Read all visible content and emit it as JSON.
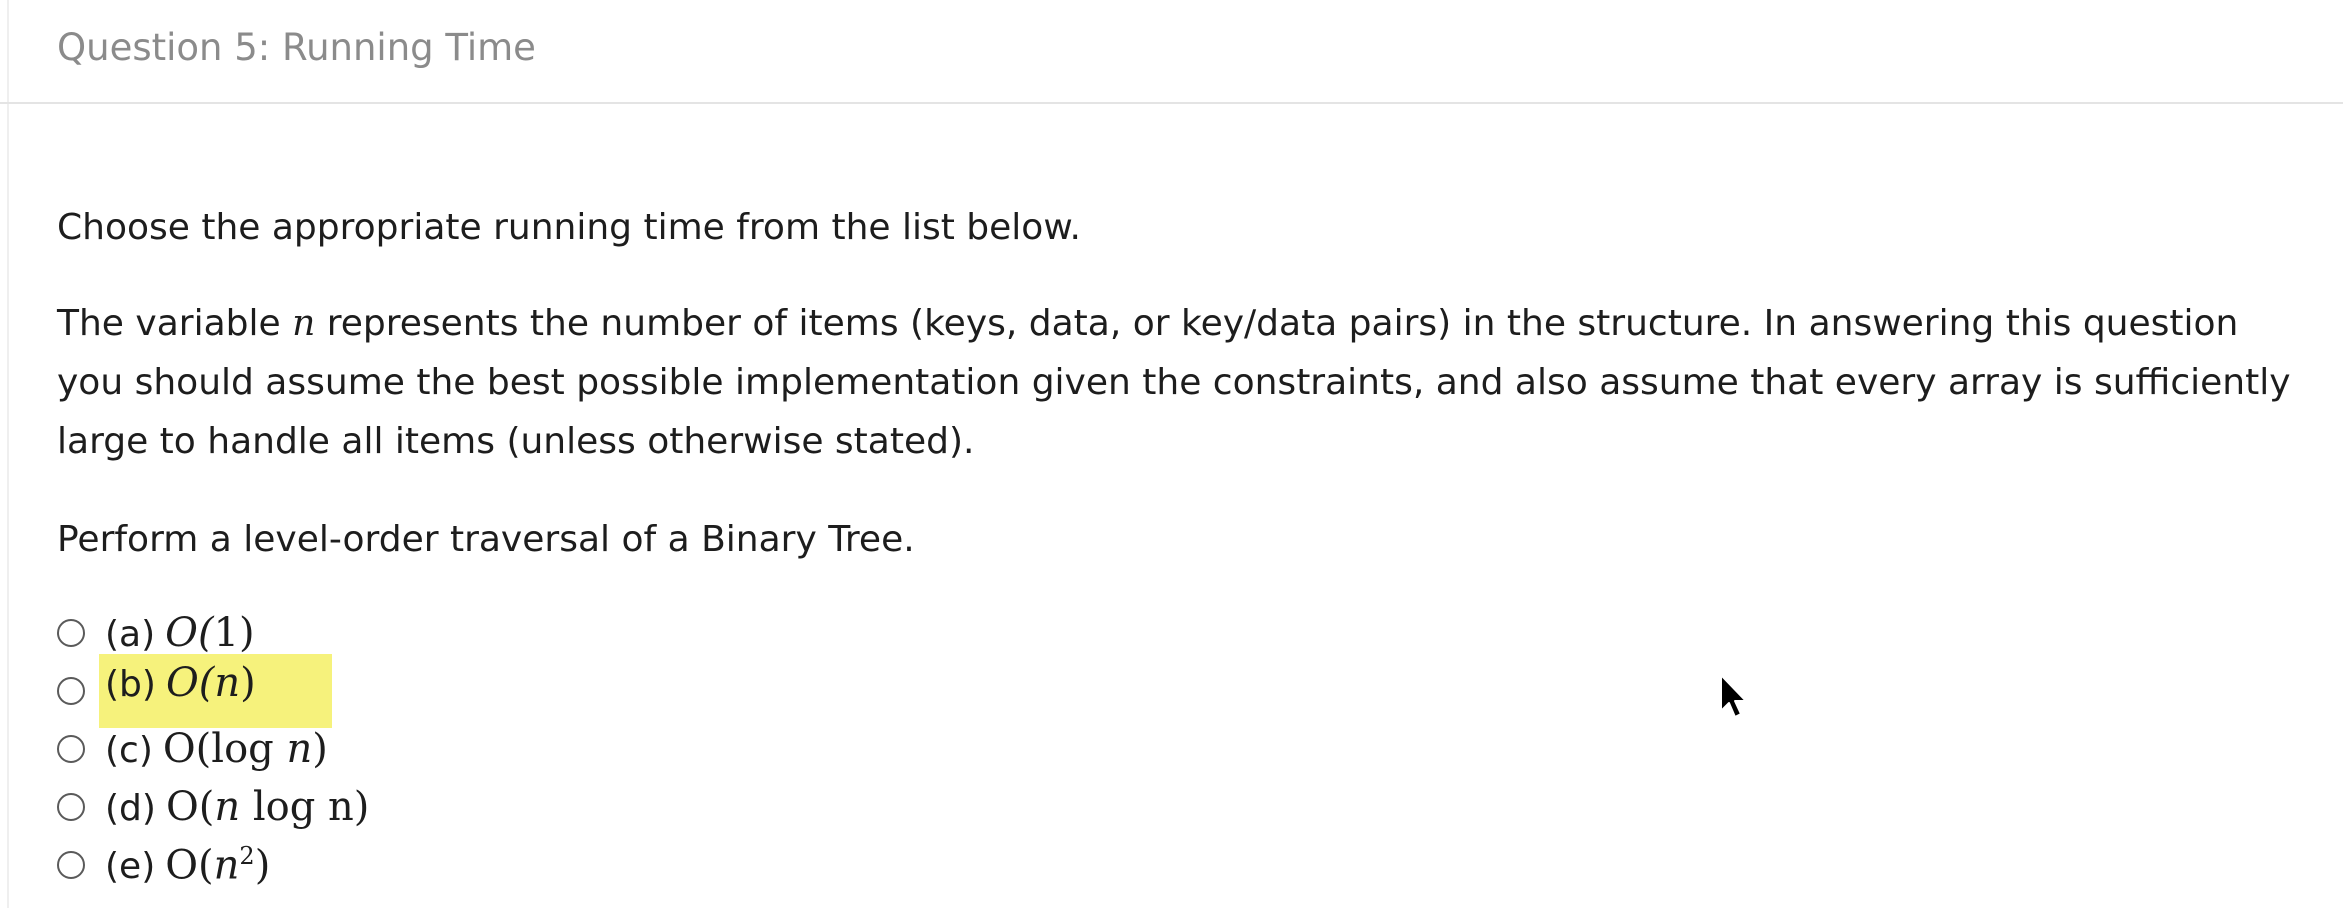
{
  "header": {
    "title": "Question 5: Running Time"
  },
  "question": {
    "instruction": "Choose the appropriate running time from the list below.",
    "variable_intro_before": "The variable ",
    "variable_symbol": "n",
    "variable_intro_after": " represents the number of items (keys, data, or key/data pairs) in the structure. In answering this question you should assume the best possible implementation given the constraints, and also assume that every array is sufficiently large to handle all items (unless otherwise stated).",
    "prompt": "Perform a level-order traversal of a Binary Tree."
  },
  "options": [
    {
      "letter": "(a)",
      "math_prefix": "O(",
      "math_var": "1",
      "math_mid": "",
      "math_suffix": ")",
      "highlighted": false,
      "selected": false
    },
    {
      "letter": "(b)",
      "math_prefix": "O(",
      "math_var": "n",
      "math_mid": "",
      "math_suffix": ")",
      "highlighted": true,
      "selected": false
    },
    {
      "letter": "(c)",
      "math_prefix": "O(log ",
      "math_var": "n",
      "math_mid": "",
      "math_suffix": ")",
      "highlighted": false,
      "selected": false
    },
    {
      "letter": "(d)",
      "math_prefix": "O(",
      "math_var": "n",
      "math_mid": " log n",
      "math_suffix": ")",
      "highlighted": false,
      "selected": false
    },
    {
      "letter": "(e)",
      "math_prefix": "O(",
      "math_var": "n",
      "math_mid": "2",
      "math_suffix": ")",
      "highlighted": false,
      "selected": false
    }
  ],
  "colors": {
    "highlight": "#f6f27c",
    "header_text": "#8b8b8b",
    "body_text": "#1d1d1d",
    "radio_border": "#5a5a5a"
  },
  "icons": {
    "cursor": "mouse-pointer-arrow-icon"
  }
}
